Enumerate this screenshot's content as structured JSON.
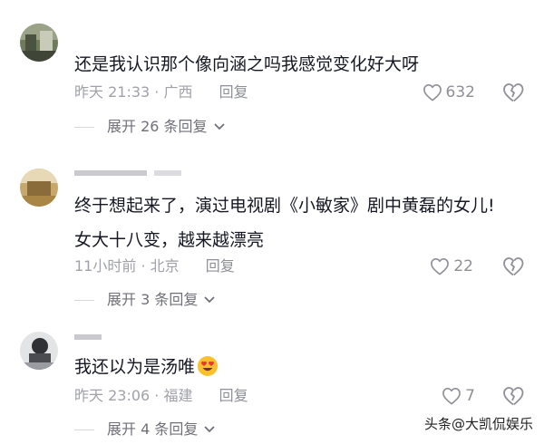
{
  "comments": [
    {
      "username": "",
      "text": "还是我认识那个像向涵之吗我感觉变化好大呀",
      "time": "昨天 21:33",
      "location": "广西",
      "reply_label": "回复",
      "likes": "632",
      "expand_label": "展开 26 条回复"
    },
    {
      "username": "",
      "text_line1": "终于想起来了，演过电视剧《小敏家》剧中黄磊的女儿!",
      "text_line2": "女大十八变，越来越漂亮",
      "time": "11小时前",
      "location": "北京",
      "reply_label": "回复",
      "likes": "22",
      "expand_label": "展开 3 条回复"
    },
    {
      "username": "",
      "text": "我还以为是汤唯",
      "emoji": "heart-eyes-emoji",
      "time": "昨天 23:06",
      "location": "福建",
      "reply_label": "回复",
      "likes": "7",
      "expand_label": "展开 4 条回复"
    }
  ],
  "separator": " · ",
  "watermark": "头条@大凯侃娱乐",
  "colors": {
    "text": "#161823",
    "meta": "#a0a2a8",
    "icon": "#8e9096"
  }
}
